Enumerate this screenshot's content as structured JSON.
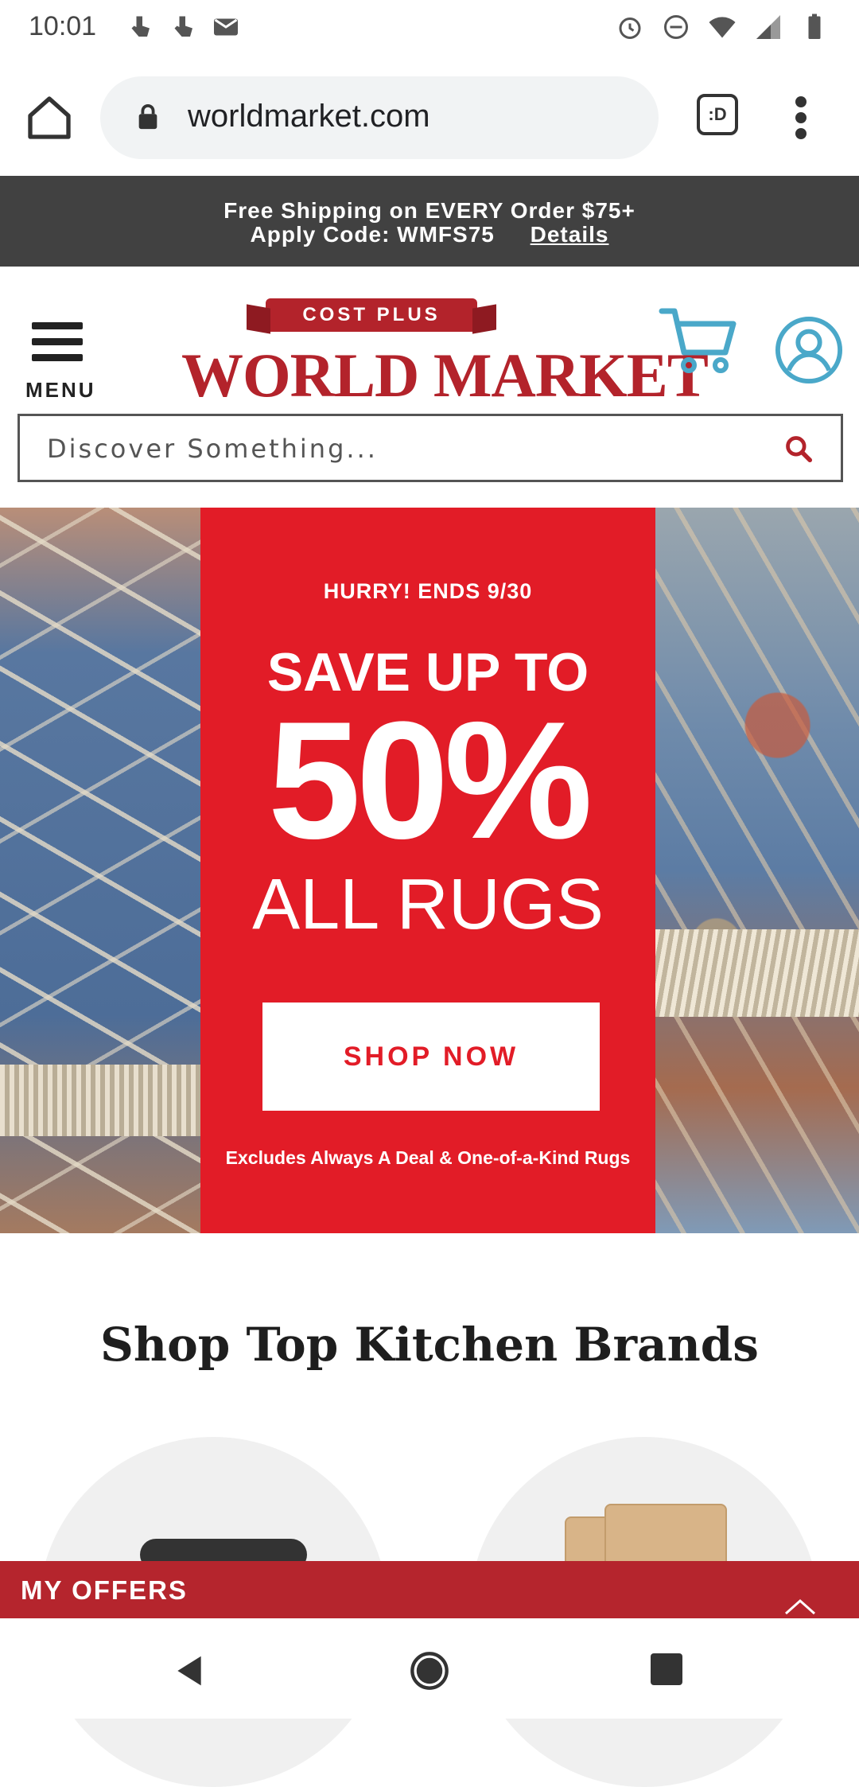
{
  "status_bar": {
    "time": "10:01"
  },
  "browser": {
    "url": "worldmarket.com",
    "tabs_label": ":D"
  },
  "promo": {
    "line1": "Free Shipping on EVERY Order $75+",
    "line2": "Apply Code: WMFS75",
    "details_link": "Details"
  },
  "header": {
    "menu_label": "MENU",
    "logo_ribbon": "COST PLUS",
    "logo_text": "WORLD MARKET"
  },
  "search": {
    "placeholder": "Discover Something..."
  },
  "hero": {
    "hurry": "HURRY! ENDS 9/30",
    "save": "SAVE UP TO",
    "percent": "50%",
    "subject": "ALL RUGS",
    "cta": "SHOP NOW",
    "disclaimer": "Excludes Always A Deal & One-of-a-Kind Rugs"
  },
  "section": {
    "title": "Shop Top Kitchen Brands"
  },
  "offers": {
    "label": "MY OFFERS"
  },
  "colors": {
    "brand_red": "#b3232b",
    "hero_red": "#e21c27",
    "promo_bg": "#414141",
    "accent_blue": "#4aa8c9"
  }
}
